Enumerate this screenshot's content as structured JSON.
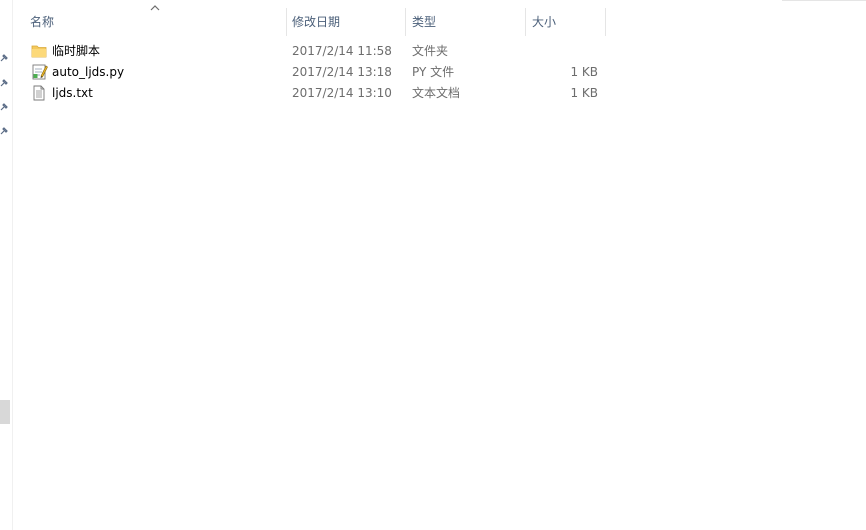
{
  "columns": {
    "name": "名称",
    "date": "修改日期",
    "type": "类型",
    "size": "大小"
  },
  "files": [
    {
      "name": "临时脚本",
      "date": "2017/2/14 11:58",
      "type": "文件夹",
      "size": "",
      "icon": "folder-icon"
    },
    {
      "name": "auto_ljds.py",
      "date": "2017/2/14 13:18",
      "type": "PY 文件",
      "size": "1 KB",
      "icon": "python-file-icon"
    },
    {
      "name": "ljds.txt",
      "date": "2017/2/14 13:10",
      "type": "文本文档",
      "size": "1 KB",
      "icon": "text-file-icon"
    }
  ],
  "sort": {
    "column": "name",
    "icon": "sort-ascending-icon"
  },
  "colors": {
    "header_text": "#4c607a",
    "detail_text": "#6d6d6d",
    "folder": "#f4c95d"
  }
}
